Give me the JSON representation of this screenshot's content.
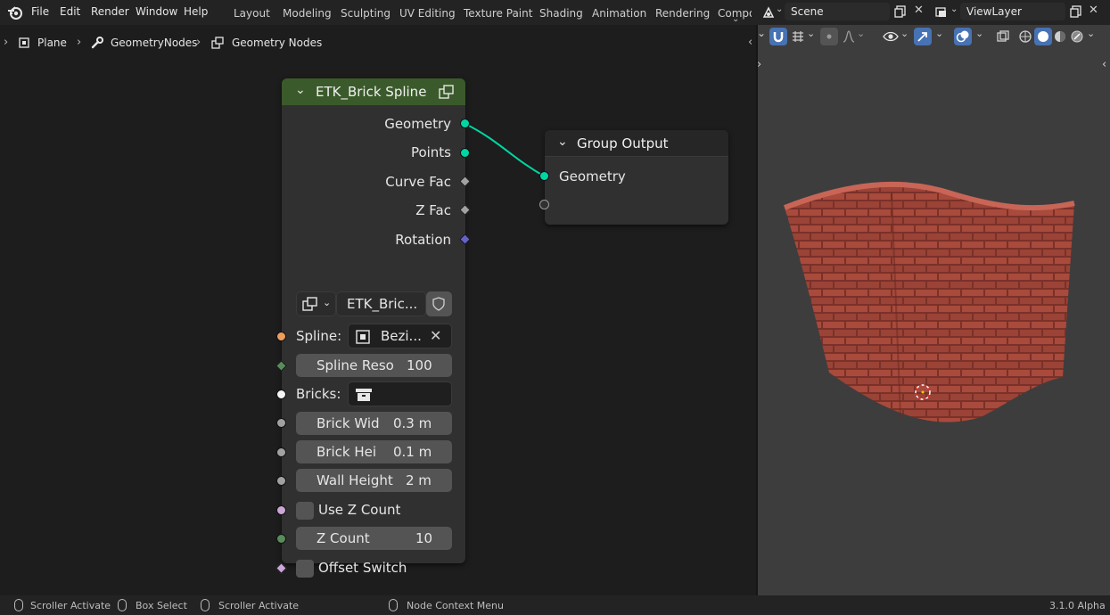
{
  "menu": [
    "File",
    "Edit",
    "Render",
    "Window",
    "Help"
  ],
  "workspaces": [
    "Layout",
    "Modeling",
    "Sculpting",
    "UV Editing",
    "Texture Paint",
    "Shading",
    "Animation",
    "Rendering",
    "Compo"
  ],
  "scene": {
    "label": "Scene",
    "view_layer": "ViewLayer"
  },
  "breadcrumb": [
    "Plane",
    "GeometryNodes",
    "Geometry Nodes"
  ],
  "brick_node": {
    "title": "ETK_Brick Spline",
    "outputs": [
      "Geometry",
      "Points",
      "Curve Fac",
      "Z Fac",
      "Rotation"
    ],
    "group_name": "ETK_Bric...",
    "spline_label": "Spline:",
    "spline_value": "Bezi...",
    "spline_reso_label": "Spline Reso",
    "spline_reso_value": "100",
    "bricks_label": "Bricks:",
    "brick_wid_label": "Brick Wid",
    "brick_wid_value": "0.3 m",
    "brick_hei_label": "Brick Hei",
    "brick_hei_value": "0.1 m",
    "wall_height_label": "Wall Height",
    "wall_height_value": "2 m",
    "use_z_count_label": "Use Z Count",
    "z_count_label": "Z Count",
    "z_count_value": "10",
    "offset_switch_label": "Offset Switch"
  },
  "group_output": {
    "title": "Group Output",
    "input": "Geometry"
  },
  "status": {
    "left_click": "Scroller Activate",
    "middle_click": "Box Select",
    "right_click": "Scroller Activate",
    "context": "Node Context Menu",
    "version": "3.1.0 Alpha"
  },
  "colors": {
    "geometry_socket": "#00d6a3",
    "float_socket": "#a1a1a1",
    "vector_socket": "#6363c7",
    "object_socket": "#ed9e5c",
    "int_socket": "#598c5c",
    "collection_socket": "#f5f5f5",
    "bool_socket": "#cca6d6",
    "node_header_green": "#3b5a2b",
    "node_header_dark": "#262626",
    "brick": "#a84a3c"
  }
}
